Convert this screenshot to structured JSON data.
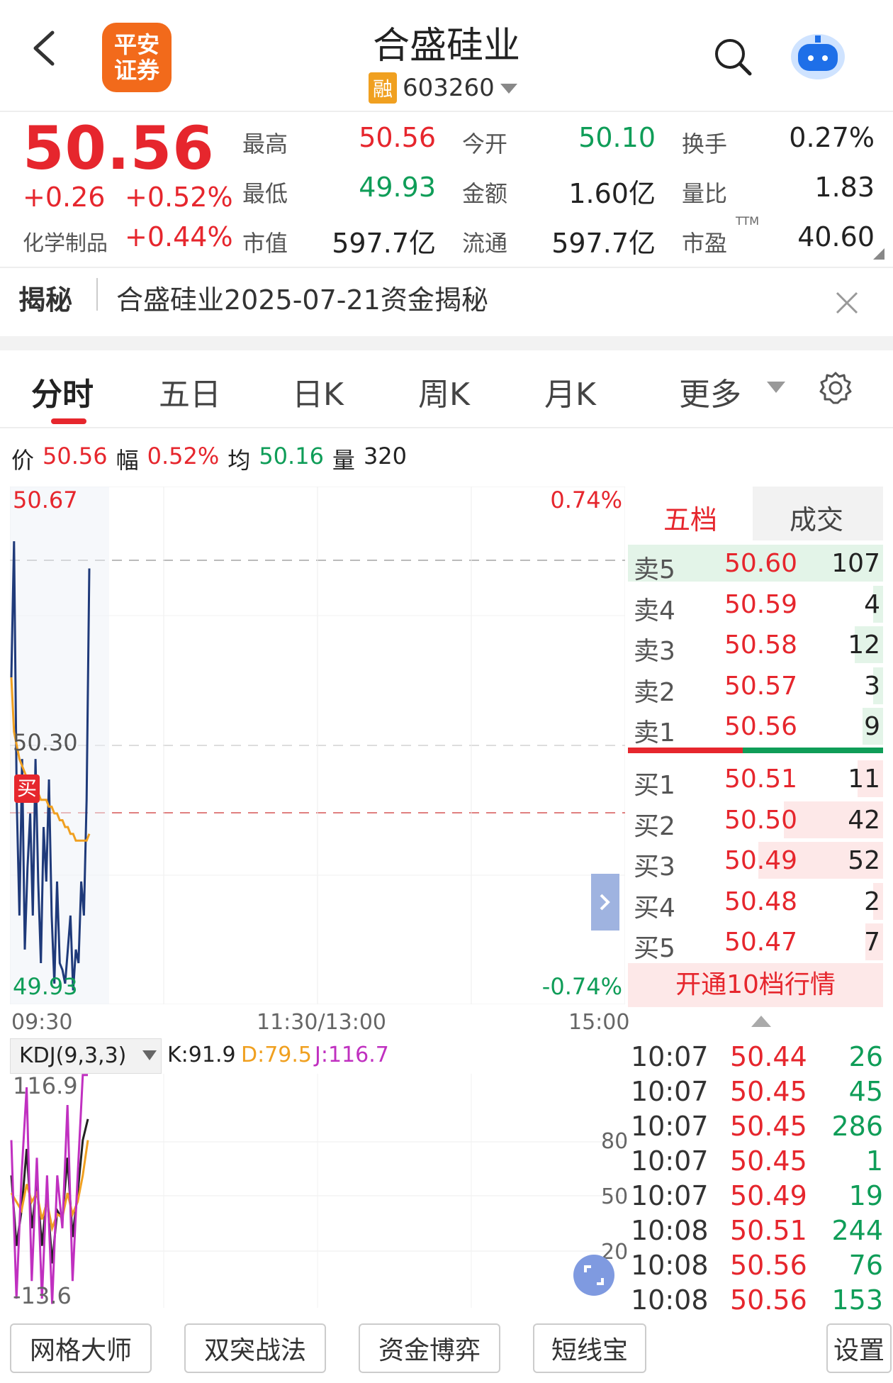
{
  "header": {
    "title": "合盛硅业",
    "rong_badge": "融",
    "code": "603260",
    "logo_line1": "平安",
    "logo_line2": "证券"
  },
  "quote": {
    "price": "50.56",
    "change": "+0.26",
    "change_pct": "+0.52%",
    "sector": "化学制品",
    "sector_pct": "+0.44%",
    "stats": [
      {
        "label": "最高",
        "value": "50.56"
      },
      {
        "label": "今开",
        "value": "50.10"
      },
      {
        "label": "换手",
        "value": "0.27%"
      },
      {
        "label": "最低",
        "value": "49.93"
      },
      {
        "label": "金额",
        "value": "1.60亿"
      },
      {
        "label": "量比",
        "value": "1.83"
      },
      {
        "label": "市值",
        "value": "597.7亿"
      },
      {
        "label": "流通",
        "value": "597.7亿"
      },
      {
        "label": "市盈",
        "value": "40.60",
        "sup": "TTM"
      }
    ]
  },
  "reveal": {
    "tag": "揭秘",
    "text": "合盛硅业2025-07-21资金揭秘"
  },
  "tabs": [
    "分时",
    "五日",
    "日K",
    "周K",
    "月K",
    "更多"
  ],
  "active_tab": "分时",
  "info_bar": {
    "price_label": "价",
    "price": "50.56",
    "amp_label": "幅",
    "amp": "0.52%",
    "avg_label": "均",
    "avg": "50.16",
    "vol_label": "量",
    "vol": "320"
  },
  "chart": {
    "top_price": "50.67",
    "top_pct": "0.74%",
    "mid_price": "50.30",
    "bottom_price": "49.93",
    "bottom_pct": "-0.74%",
    "buy_marker": "买",
    "time_start": "09:30",
    "time_mid": "11:30/13:00",
    "time_end": "15:00"
  },
  "chart_data": {
    "type": "line",
    "ylim": [
      49.93,
      50.67
    ],
    "series": [
      {
        "values": [
          50.4,
          50.6,
          50.22,
          50.05,
          50.28,
          50.0,
          50.12,
          50.2,
          50.05,
          50.28,
          50.1,
          49.98,
          50.18,
          50.1,
          50.25,
          50.05,
          49.95,
          50.1,
          49.98,
          49.97,
          49.95,
          50.0,
          50.05,
          49.94,
          50.0,
          49.98,
          50.1,
          50.05,
          50.22,
          50.56
        ]
      },
      {
        "values": [
          50.4,
          50.32,
          50.3,
          50.28,
          50.27,
          50.26,
          50.25,
          50.25,
          50.24,
          50.24,
          50.23,
          50.22,
          50.22,
          50.22,
          50.21,
          50.21,
          50.2,
          50.2,
          50.19,
          50.19,
          50.18,
          50.18,
          50.17,
          50.17,
          50.16,
          50.16,
          50.16,
          50.16,
          50.16,
          50.17
        ]
      }
    ]
  },
  "kdj": {
    "label": "KDJ(9,3,3)",
    "k": "K:91.9",
    "d": "D:79.5",
    "j": "J:116.7",
    "top": "116.9",
    "bottom": "-13.6",
    "levels": [
      "80",
      "50",
      "20"
    ],
    "chart_data": {
      "type": "line",
      "ylim": [
        -13.6,
        116.9
      ],
      "series": [
        {
          "name": "K",
          "values": [
            60,
            20,
            40,
            75,
            30,
            55,
            20,
            50,
            10,
            40,
            35,
            70,
            25,
            50,
            80,
            92
          ]
        },
        {
          "name": "D",
          "values": [
            50,
            45,
            40,
            55,
            45,
            50,
            35,
            45,
            30,
            38,
            36,
            50,
            38,
            45,
            60,
            80
          ]
        },
        {
          "name": "J",
          "values": [
            80,
            -10,
            60,
            110,
            0,
            70,
            -10,
            60,
            -13,
            60,
            30,
            100,
            0,
            60,
            117,
            117
          ]
        }
      ]
    }
  },
  "orderbook": {
    "tab1": "五档",
    "tab2": "成交",
    "asks": [
      {
        "label": "卖5",
        "price": "50.60",
        "vol": "107",
        "bar": 1.0
      },
      {
        "label": "卖4",
        "price": "50.59",
        "vol": "4",
        "bar": 0.04
      },
      {
        "label": "卖3",
        "price": "50.58",
        "vol": "12",
        "bar": 0.11
      },
      {
        "label": "卖2",
        "price": "50.57",
        "vol": "3",
        "bar": 0.03
      },
      {
        "label": "卖1",
        "price": "50.56",
        "vol": "9",
        "bar": 0.08
      }
    ],
    "bids": [
      {
        "label": "买1",
        "price": "50.51",
        "vol": "11",
        "bar": 0.1
      },
      {
        "label": "买2",
        "price": "50.50",
        "vol": "42",
        "bar": 0.39
      },
      {
        "label": "买3",
        "price": "50.49",
        "vol": "52",
        "bar": 0.49
      },
      {
        "label": "买4",
        "price": "50.48",
        "vol": "2",
        "bar": 0.02
      },
      {
        "label": "买5",
        "price": "50.47",
        "vol": "7",
        "bar": 0.07
      }
    ],
    "open_10": "开通10档行情"
  },
  "ticks": [
    {
      "time": "10:07",
      "price": "50.44",
      "vol": "26"
    },
    {
      "time": "10:07",
      "price": "50.45",
      "vol": "45"
    },
    {
      "time": "10:07",
      "price": "50.45",
      "vol": "286"
    },
    {
      "time": "10:07",
      "price": "50.45",
      "vol": "1"
    },
    {
      "time": "10:07",
      "price": "50.49",
      "vol": "19"
    },
    {
      "time": "10:08",
      "price": "50.51",
      "vol": "244"
    },
    {
      "time": "10:08",
      "price": "50.56",
      "vol": "76"
    },
    {
      "time": "10:08",
      "price": "50.56",
      "vol": "153"
    }
  ],
  "bottom_buttons": [
    "网格大师",
    "双突战法",
    "资金博弈",
    "短线宝",
    "设置"
  ],
  "colors": {
    "up": "#e6262d",
    "down": "#0f9d58",
    "price_line": "#1f3a7a",
    "avg_line": "#f0a020"
  }
}
